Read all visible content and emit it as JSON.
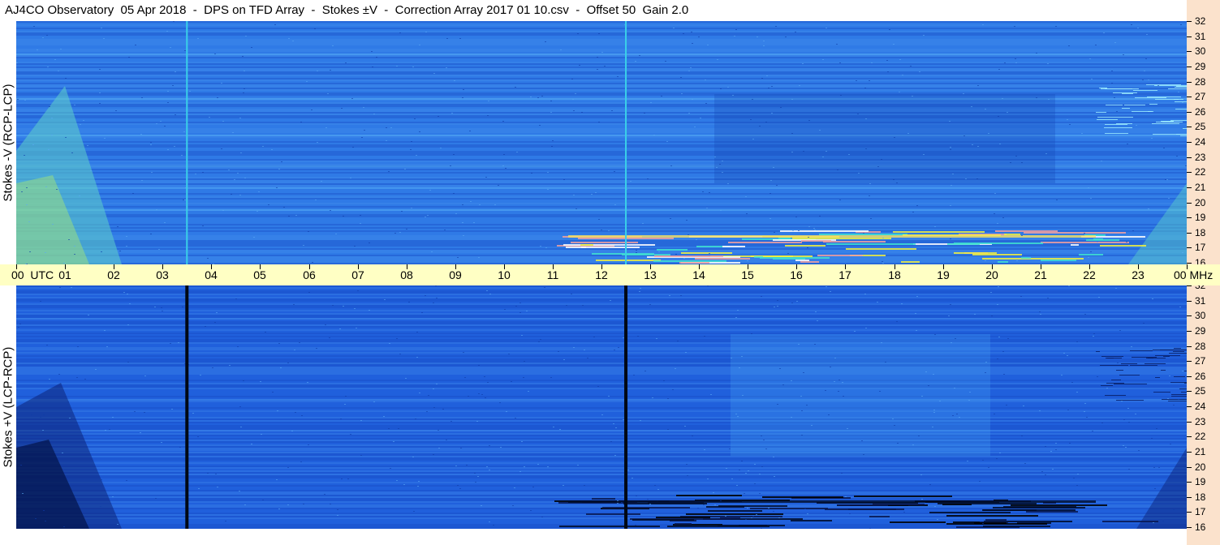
{
  "title": "AJ4CO Observatory  05 Apr 2018  -  DPS on TFD Array  -  Stokes ±V  -  Correction Array 2017 01 10.csv  -  Offset 50  Gain 2.0",
  "panels": {
    "top": {
      "ylabel": "Stokes -V (RCP-LCP)"
    },
    "bottom": {
      "ylabel": "Stokes +V (LCP-RCP)"
    }
  },
  "time_axis": {
    "labels": [
      "00  UTC",
      "01",
      "02",
      "03",
      "04",
      "05",
      "06",
      "07",
      "08",
      "09",
      "10",
      "11",
      "12",
      "13",
      "14",
      "15",
      "16",
      "17",
      "18",
      "19",
      "20",
      "21",
      "22",
      "23",
      "00 MHz"
    ]
  },
  "freq_axis": {
    "labels": [
      "32",
      "31",
      "30",
      "29",
      "28",
      "27",
      "26",
      "25",
      "24",
      "23",
      "22",
      "21",
      "20",
      "19",
      "18",
      "17",
      "16"
    ]
  },
  "colors": {
    "background_blue": "#1e6fe0",
    "dark_blue": "#0a2f9a",
    "cyan": "#18c0e8",
    "yellow": "#f0f040",
    "timebar": "#ffffc4",
    "freqbar": "#fbe2cc"
  },
  "chart_data": [
    {
      "type": "heatmap",
      "title": "Stokes -V (RCP-LCP)",
      "x_range_utc_hours": [
        0,
        24
      ],
      "y_range_mhz": [
        16,
        32
      ],
      "features": [
        {
          "utc": 3.5,
          "kind": "vertical line",
          "color": "cyan"
        },
        {
          "utc": 12.5,
          "kind": "vertical line",
          "color": "cyan"
        }
      ]
    },
    {
      "type": "heatmap",
      "title": "Stokes +V (LCP-RCP)",
      "x_range_utc_hours": [
        0,
        24
      ],
      "y_range_mhz": [
        16,
        32
      ],
      "features": [
        {
          "utc": 3.5,
          "kind": "vertical line",
          "color": "black"
        },
        {
          "utc": 12.5,
          "kind": "vertical line",
          "color": "black"
        }
      ]
    }
  ]
}
